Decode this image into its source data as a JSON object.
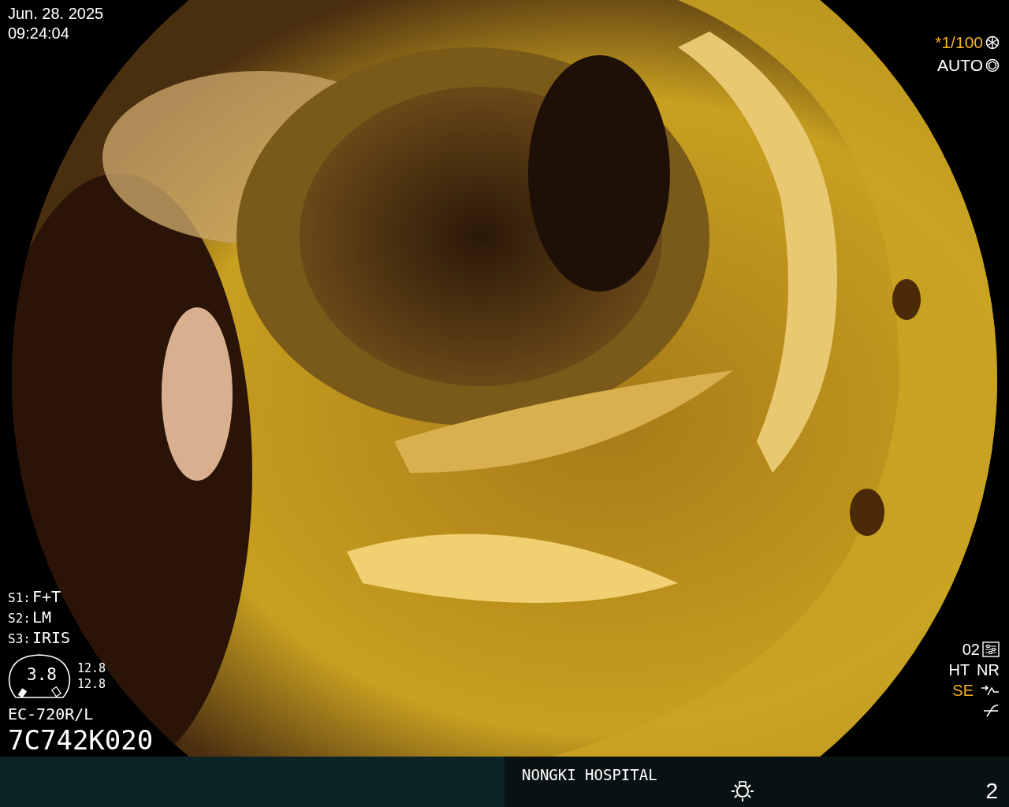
{
  "date": "Jun. 28. 2025",
  "time": "09:24:04",
  "settings": [
    {
      "label": "S1:",
      "value": "F+T"
    },
    {
      "label": "S2:",
      "value": "LM"
    },
    {
      "label": "S3:",
      "value": "IRIS"
    }
  ],
  "gauge": {
    "value": "3.8",
    "readings": [
      "12.8",
      "12.8"
    ]
  },
  "scope_model": "EC-720R/L",
  "scope_serial": "7C742K020",
  "exposure": [
    {
      "text": "*1/100",
      "active": true,
      "kind": "shutter"
    },
    {
      "text": "AUTO",
      "active": false,
      "kind": "iris"
    }
  ],
  "preset": "02",
  "mode_rows": [
    {
      "items": [
        {
          "text": "HT",
          "active": false,
          "kind": "plain"
        },
        {
          "text": "NR",
          "active": false,
          "kind": "plain"
        }
      ]
    },
    {
      "items": [
        {
          "text": "SE",
          "active": true,
          "kind": "enhance"
        }
      ]
    }
  ],
  "hospital": "NONGKI HOSPITAL",
  "page": "2"
}
